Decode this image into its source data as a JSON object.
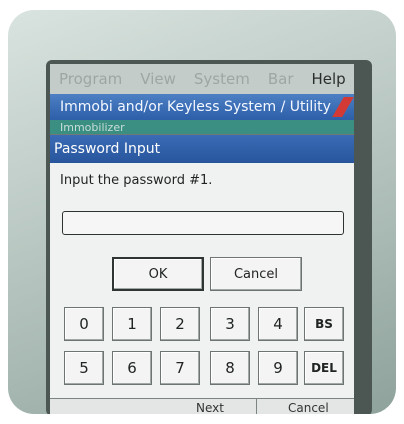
{
  "menu": {
    "items": [
      "Program",
      "View",
      "System",
      "Bar"
    ],
    "help": "Help"
  },
  "window": {
    "title": "Immobi and/or Keyless System / Utility",
    "behind_title": "Immobilizer"
  },
  "dialog": {
    "title": "Password Input",
    "prompt": "Input the password #1.",
    "password_value": "",
    "ok_label": "OK",
    "cancel_label": "Cancel"
  },
  "keypad": {
    "row1": [
      "0",
      "1",
      "2",
      "3",
      "4",
      "BS"
    ],
    "row2": [
      "5",
      "6",
      "7",
      "8",
      "9",
      "DEL"
    ]
  },
  "bottom": {
    "next_label": "Next",
    "cancel_label": "Cancel"
  },
  "colors": {
    "titlebar": "#2d5fa9",
    "accent_red": "#d33a35",
    "screen_bg": "#e8ecea"
  }
}
